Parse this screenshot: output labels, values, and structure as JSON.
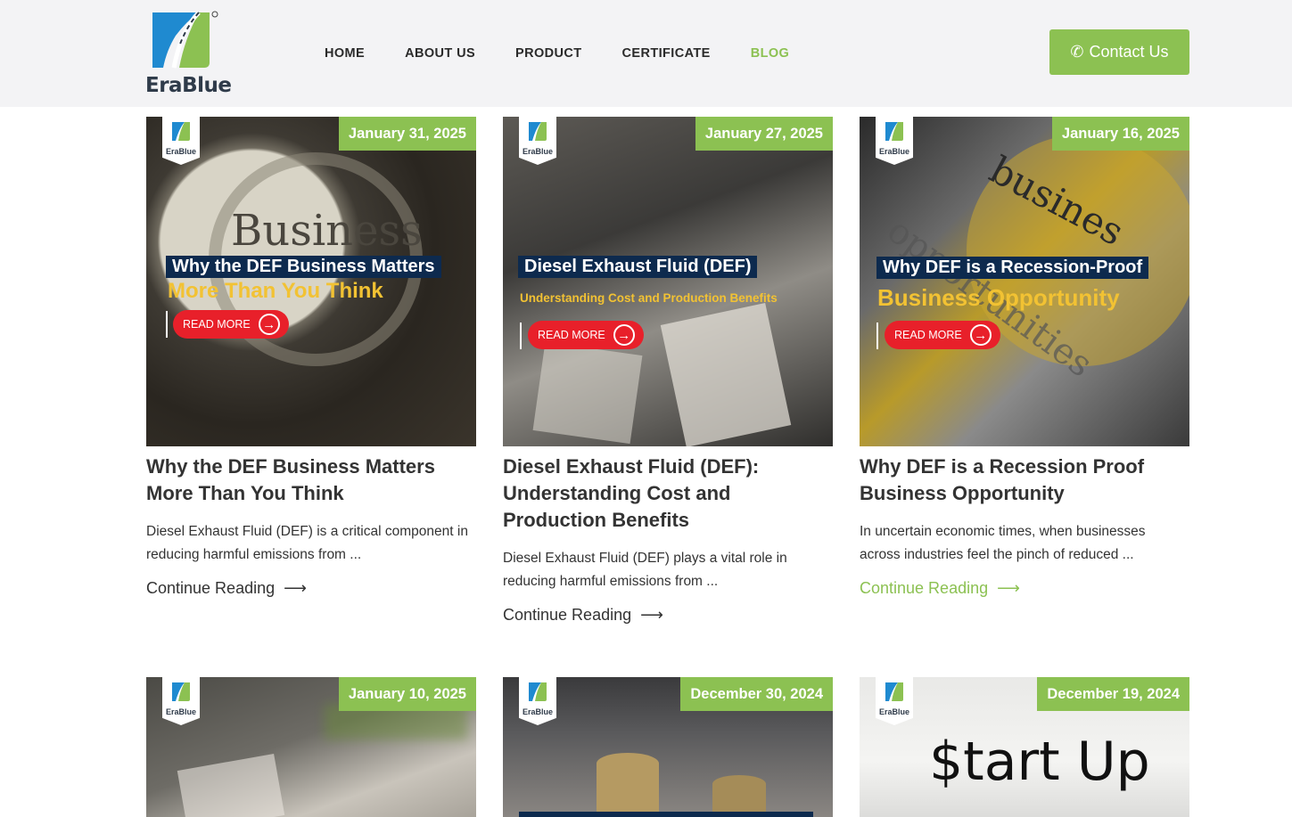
{
  "brand": {
    "name": "EraBlue",
    "green": "#8cc152",
    "navy": "#0d2a4e",
    "red": "#e8202a"
  },
  "nav": {
    "items": [
      {
        "label": "HOME"
      },
      {
        "label": "ABOUT US"
      },
      {
        "label": "PRODUCT"
      },
      {
        "label": "CERTIFICATE"
      },
      {
        "label": "BLOG",
        "active": true
      }
    ],
    "contact_icon": "phone-icon",
    "contact_label": "Contact Us"
  },
  "posts": [
    {
      "date": "January 31, 2025",
      "overlay_title": "Why the DEF Business Matters",
      "overlay_subtitle": "More Than You Think",
      "image_word": "Business",
      "read_more": "READ MORE",
      "title": "Why the DEF Business Matters More Than You Think",
      "excerpt": "Diesel Exhaust Fluid (DEF) is a critical component in reducing harmful emissions from ...",
      "continue": "Continue Reading"
    },
    {
      "date": "January 27, 2025",
      "overlay_title": "Diesel Exhaust Fluid (DEF)",
      "overlay_subtitle": "Understanding Cost and Production Benefits",
      "read_more": "READ MORE",
      "title": "Diesel Exhaust Fluid (DEF): Understanding Cost and Production Benefits",
      "excerpt": "Diesel Exhaust Fluid (DEF) plays a vital role in reducing harmful emissions from ...",
      "continue": "Continue Reading"
    },
    {
      "date": "January 16, 2025",
      "overlay_title": "Why DEF is a Recession-Proof",
      "overlay_subtitle": "Business Opportunity",
      "image_word": "busines",
      "image_word_2": "opportunities",
      "read_more": "READ MORE",
      "title": "Why DEF is a Recession Proof Business Opportunity",
      "excerpt": "In uncertain economic times, when businesses across industries feel the pinch of reduced ...",
      "continue": "Continue Reading"
    },
    {
      "date": "January 10, 2025"
    },
    {
      "date": "December 30, 2024"
    },
    {
      "date": "December 19, 2024",
      "image_word": "$tart Up"
    }
  ],
  "mini_logo_text": "EraBlue"
}
